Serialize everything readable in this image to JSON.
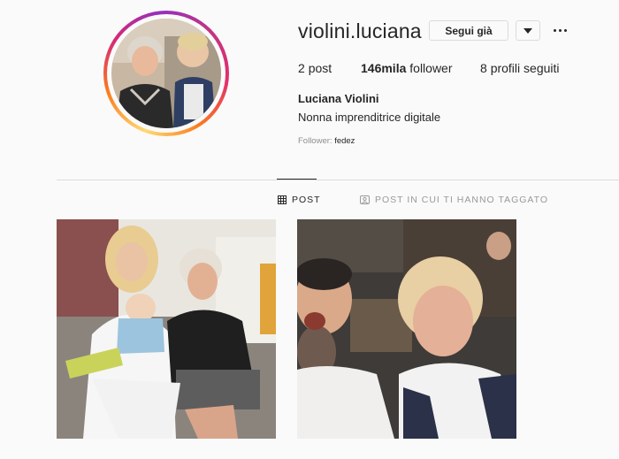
{
  "profile": {
    "username": "violini.luciana",
    "follow_button_label": "Segui già",
    "dropdown_icon": "caret-down-icon",
    "more_icon": "ellipsis-icon",
    "stats": {
      "posts_count": "2",
      "posts_label": "post",
      "followers_count": "146mila",
      "followers_label": "follower",
      "following_count": "8",
      "following_label": "profili seguiti"
    },
    "full_name": "Luciana Violini",
    "bio": "Nonna imprenditrice digitale",
    "followed_by_label": "Follower:",
    "followed_by_user": "fedez"
  },
  "tabs": [
    {
      "label": "POST",
      "icon": "grid-icon",
      "active": true
    },
    {
      "label": "POST IN CUI TI HANNO TAGGATO",
      "icon": "tag-icon",
      "active": false
    }
  ],
  "posts": [
    {
      "icon": "photo-post-1"
    },
    {
      "icon": "photo-post-2"
    }
  ]
}
